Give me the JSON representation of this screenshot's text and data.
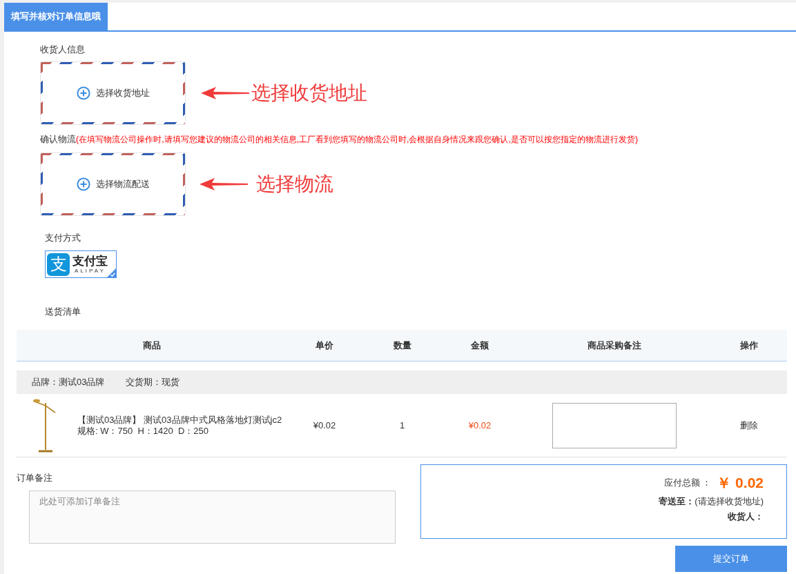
{
  "header": {
    "tabs": [
      {
        "label": "填写并核对订单信息哦",
        "selected": true
      }
    ]
  },
  "consignee": {
    "label": "收货人信息",
    "button": "选择收货地址",
    "annotation": "选择收货地址"
  },
  "logistics": {
    "label": "确认物流",
    "note": "(在填写物流公司操作时,请填写您建议的物流公司的相关信息,工厂看到您填写的物流公司时,会根据自身情况来跟您确认,是否可以按您指定的物流进行发货)",
    "button": "选择物流配送",
    "annotation": "选择物流"
  },
  "payment": {
    "label": "支付方式",
    "methods": [
      {
        "glyph": "支",
        "name": "支付宝",
        "latin": "ALIPAY",
        "selected": true
      }
    ]
  },
  "delivery_list": {
    "label": "送货清单",
    "table": {
      "columns": [
        "商品",
        "单价",
        "数量",
        "金额",
        "商品采购备注",
        "操作"
      ],
      "groups": [
        {
          "brand": "品牌：测试03品牌",
          "delivery": "交货期：现货",
          "rows": [
            {
              "title": "【测试03品牌】 测试03品牌中式风格落地灯测试jc2",
              "spec": "规格: W：750  H：1420  D：250",
              "unit_price": "¥0.02",
              "quantity": "1",
              "amount": "¥0.02",
              "action": "删除"
            }
          ]
        }
      ]
    }
  },
  "order_note": {
    "label": "订单备注",
    "placeholder": "此处可添加订单备注"
  },
  "summary": {
    "total_label": "应付总额 ：",
    "total": "￥ 0.02",
    "ship_to_label": "寄送至：",
    "ship_to": "(请选择收货地址)",
    "receiver_label": "收货人："
  },
  "submit_button": "提交订单"
}
